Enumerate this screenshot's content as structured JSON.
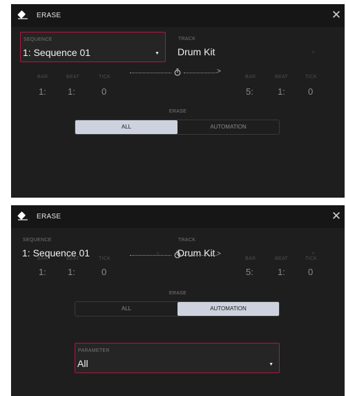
{
  "dialogs": [
    {
      "title": "ERASE",
      "close_glyph": "✕",
      "sequence": {
        "label": "SEQUENCE",
        "value": "1: Sequence 01"
      },
      "track": {
        "label": "TRACK",
        "value": "Drum Kit"
      },
      "start": {
        "bar_label": "BAR",
        "beat_label": "BEAT",
        "tick_label": "TICK",
        "bar": "1:",
        "beat": "1:",
        "tick": "0"
      },
      "end": {
        "bar_label": "BAR",
        "beat_label": "BEAT",
        "tick_label": "TICK",
        "bar": "5:",
        "beat": "1:",
        "tick": "0"
      },
      "erase_label": "ERASE",
      "options": [
        "ALL",
        "AUTOMATION"
      ],
      "selected_option": "ALL"
    },
    {
      "title": "ERASE",
      "close_glyph": "✕",
      "sequence": {
        "label": "SEQUENCE",
        "value": "1: Sequence 01"
      },
      "track": {
        "label": "TRACK",
        "value": "Drum Kit"
      },
      "start": {
        "bar_label": "BAR",
        "beat_label": "BEAT",
        "tick_label": "TICK",
        "bar": "1:",
        "beat": "1:",
        "tick": "0"
      },
      "end": {
        "bar_label": "BAR",
        "beat_label": "BEAT",
        "tick_label": "TICK",
        "bar": "5:",
        "beat": "1:",
        "tick": "0"
      },
      "erase_label": "ERASE",
      "options": [
        "ALL",
        "AUTOMATION"
      ],
      "selected_option": "AUTOMATION",
      "parameter": {
        "label": "PARAMETER",
        "value": "All"
      }
    }
  ],
  "icons": {
    "title": "eraser-icon",
    "close": "close-icon",
    "caret": "caret-down-icon",
    "timer": "stopwatch-icon"
  },
  "colors": {
    "accent": "#b3163f",
    "segment_active": "#cdd2de",
    "dialog_bg": "#1e1e1e",
    "titlebar_bg": "#161616"
  }
}
